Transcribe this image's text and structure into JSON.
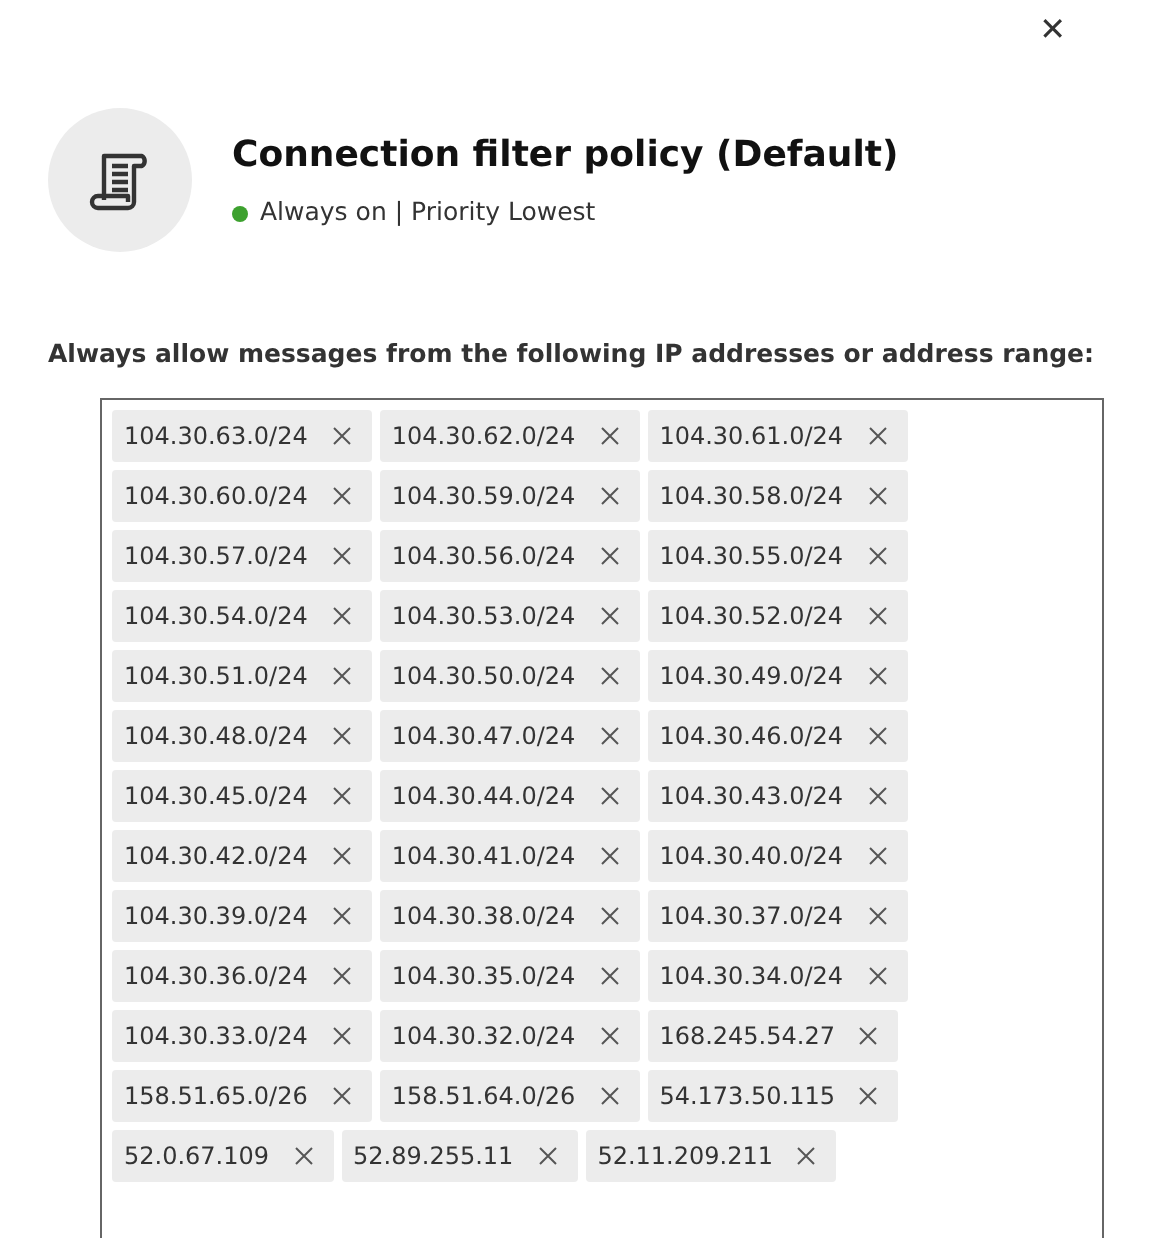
{
  "close_button": {
    "label": "✕"
  },
  "header": {
    "title": "Connection filter policy (Default)",
    "status": {
      "text": "Always on | Priority Lowest",
      "color": "#3da12f"
    }
  },
  "allow_list": {
    "label": "Always allow messages from the following IP addresses or address range:",
    "items": [
      {
        "text": "104.30.63.0/24"
      },
      {
        "text": "104.30.62.0/24"
      },
      {
        "text": "104.30.61.0/24"
      },
      {
        "text": "104.30.60.0/24"
      },
      {
        "text": "104.30.59.0/24"
      },
      {
        "text": "104.30.58.0/24"
      },
      {
        "text": "104.30.57.0/24"
      },
      {
        "text": "104.30.56.0/24"
      },
      {
        "text": "104.30.55.0/24"
      },
      {
        "text": "104.30.54.0/24"
      },
      {
        "text": "104.30.53.0/24"
      },
      {
        "text": "104.30.52.0/24"
      },
      {
        "text": "104.30.51.0/24"
      },
      {
        "text": "104.30.50.0/24"
      },
      {
        "text": "104.30.49.0/24"
      },
      {
        "text": "104.30.48.0/24"
      },
      {
        "text": "104.30.47.0/24"
      },
      {
        "text": "104.30.46.0/24"
      },
      {
        "text": "104.30.45.0/24"
      },
      {
        "text": "104.30.44.0/24"
      },
      {
        "text": "104.30.43.0/24"
      },
      {
        "text": "104.30.42.0/24"
      },
      {
        "text": "104.30.41.0/24"
      },
      {
        "text": "104.30.40.0/24"
      },
      {
        "text": "104.30.39.0/24"
      },
      {
        "text": "104.30.38.0/24"
      },
      {
        "text": "104.30.37.0/24"
      },
      {
        "text": "104.30.36.0/24"
      },
      {
        "text": "104.30.35.0/24"
      },
      {
        "text": "104.30.34.0/24"
      },
      {
        "text": "104.30.33.0/24"
      },
      {
        "text": "104.30.32.0/24"
      },
      {
        "text": "168.245.54.27"
      },
      {
        "text": "158.51.65.0/26"
      },
      {
        "text": "158.51.64.0/26"
      },
      {
        "text": "54.173.50.115"
      },
      {
        "text": "52.0.67.109"
      },
      {
        "text": "52.89.255.11"
      },
      {
        "text": "52.11.209.211"
      }
    ]
  }
}
